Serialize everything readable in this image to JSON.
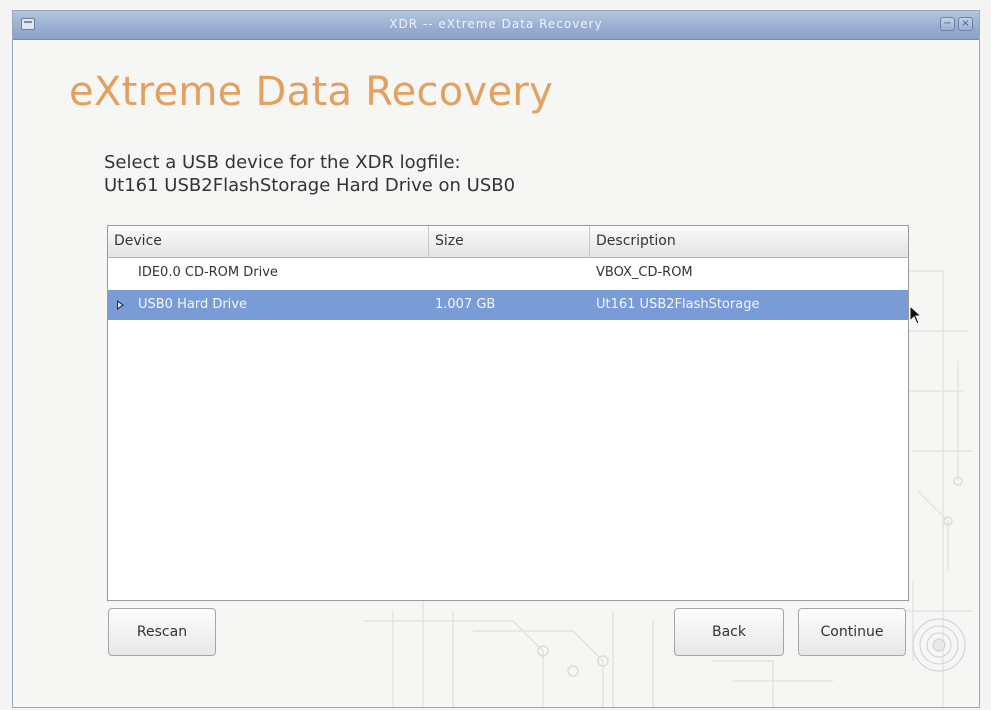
{
  "window": {
    "title": "XDR -- eXtreme Data Recovery"
  },
  "heading": "eXtreme Data Recovery",
  "prompt": {
    "line1": "Select a USB device for the XDR logfile:",
    "line2": "Ut161 USB2FlashStorage Hard Drive on USB0"
  },
  "table": {
    "columns": [
      "Device",
      "Size",
      "Description"
    ],
    "rows": [
      {
        "device": "IDE0.0 CD-ROM Drive",
        "size": "",
        "description": "VBOX_CD-ROM",
        "selected": false
      },
      {
        "device": "USB0 Hard Drive",
        "size": "1.007 GB",
        "description": "Ut161 USB2FlashStorage",
        "selected": true
      }
    ]
  },
  "buttons": {
    "rescan": "Rescan",
    "back": "Back",
    "continue": "Continue"
  },
  "colors": {
    "heading": "#e2a160",
    "selection": "#7a9cd6",
    "titlebar": "#98add0"
  },
  "icons": {
    "window": "window-icon",
    "minimize": "minimize-icon",
    "close": "close-icon",
    "expander": "expander-triangle-icon",
    "cursor": "mouse-pointer-icon"
  }
}
